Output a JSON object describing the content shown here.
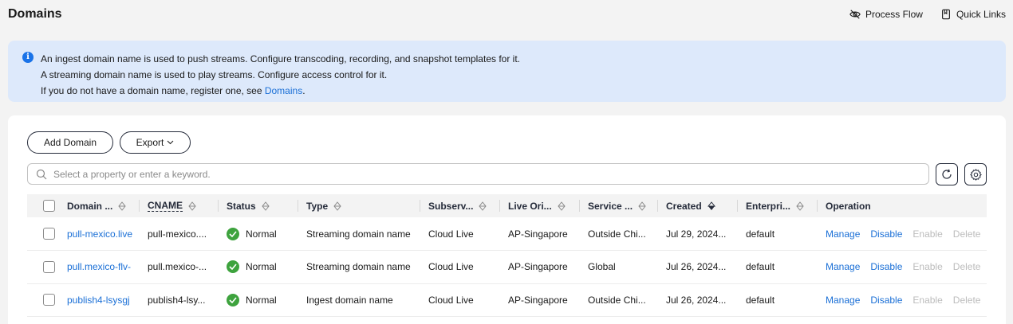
{
  "header": {
    "title": "Domains",
    "links": [
      {
        "label": "Process Flow",
        "icon": "eye-icon"
      },
      {
        "label": "Quick Links",
        "icon": "bookmark-icon"
      }
    ]
  },
  "notice": {
    "line1": "An ingest domain name is used to push streams. Configure transcoding, recording, and snapshot templates for it.",
    "line2": "A streaming domain name is used to play streams. Configure access control for it.",
    "line3_prefix": "If you do not have a domain name, register one, see ",
    "line3_link": "Domains",
    "line3_suffix": "."
  },
  "toolbar": {
    "add_label": "Add Domain",
    "export_label": "Export",
    "search_placeholder": "Select a property or enter a keyword."
  },
  "table": {
    "columns": [
      "Domain ...",
      "CNAME",
      "Status",
      "Type",
      "Subserv...",
      "Live Ori...",
      "Service ...",
      "Created",
      "Enterpri...",
      "Operation"
    ],
    "rows": [
      {
        "domain": "pull-mexico.live",
        "cname": "pull-mexico....",
        "status": "Normal",
        "type": "Streaming domain name",
        "subservice": "Cloud Live",
        "origin": "AP-Singapore",
        "service": "Outside Chi...",
        "created": "Jul 29, 2024...",
        "enterprise": "default"
      },
      {
        "domain": "pull.mexico-flv-",
        "cname": "pull.mexico-...",
        "status": "Normal",
        "type": "Streaming domain name",
        "subservice": "Cloud Live",
        "origin": "AP-Singapore",
        "service": "Global",
        "created": "Jul 26, 2024...",
        "enterprise": "default"
      },
      {
        "domain": "publish4-lsysgj",
        "cname": "publish4-lsy...",
        "status": "Normal",
        "type": "Ingest domain name",
        "subservice": "Cloud Live",
        "origin": "AP-Singapore",
        "service": "Outside Chi...",
        "created": "Jul 26, 2024...",
        "enterprise": "default"
      }
    ],
    "ops": {
      "manage": "Manage",
      "disable": "Disable",
      "enable": "Enable",
      "delete": "Delete"
    }
  },
  "colors": {
    "accent": "#1a6fd6",
    "notice_bg": "#dde9fb",
    "status_ok": "#3ea33e",
    "disabled": "#bcbcbc"
  }
}
